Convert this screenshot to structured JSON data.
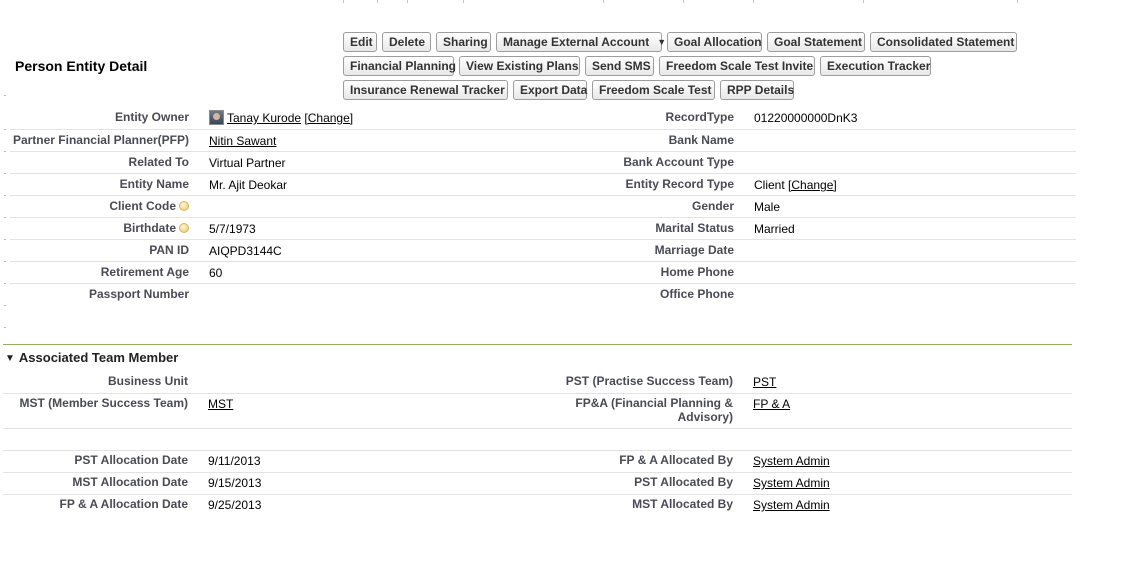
{
  "page_title": "Person Entity Detail",
  "buttons": {
    "row1": [
      "Edit",
      "Delete",
      "Sharing",
      "Manage External Account",
      "Goal Allocation",
      "Goal Statement",
      "Consolidated Statement"
    ],
    "row2": [
      "Financial Planning",
      "View Existing Plans",
      "Send SMS",
      "Freedom Scale Test Invite",
      "Execution Tracker"
    ],
    "row3": [
      "Insurance Renewal Tracker",
      "Export Data",
      "Freedom Scale Test",
      "RPP Details"
    ]
  },
  "detail": {
    "left": [
      {
        "label": "Entity Owner",
        "value": "Tanay Kurode",
        "change": "[Change]"
      },
      {
        "label": "Partner Financial Planner(PFP)",
        "value": "Nitin Sawant"
      },
      {
        "label": "Related To",
        "value": "Virtual Partner"
      },
      {
        "label": "Entity Name",
        "value": "Mr. Ajit Deokar"
      },
      {
        "label": "Client Code",
        "value": ""
      },
      {
        "label": "Birthdate",
        "value": "5/7/1973"
      },
      {
        "label": "PAN ID",
        "value": "AIQPD3144C"
      },
      {
        "label": "Retirement Age",
        "value": "60"
      },
      {
        "label": "Passport Number",
        "value": ""
      }
    ],
    "right": [
      {
        "label": "RecordType",
        "value": "01220000000DnK3"
      },
      {
        "label": "Bank Name",
        "value": ""
      },
      {
        "label": "Bank Account Type",
        "value": ""
      },
      {
        "label": "Entity Record Type",
        "value": "Client",
        "change": "[Change]"
      },
      {
        "label": "Gender",
        "value": "Male"
      },
      {
        "label": "Marital Status",
        "value": "Married"
      },
      {
        "label": "Marriage Date",
        "value": ""
      },
      {
        "label": "Home Phone",
        "value": ""
      },
      {
        "label": "Office Phone",
        "value": ""
      }
    ]
  },
  "team_section": {
    "title": "Associated Team Member",
    "rows": [
      {
        "left_label": "Business Unit",
        "left_value": "",
        "right_label": "PST (Practise Success Team)",
        "right_value": "PST"
      },
      {
        "left_label": "MST (Member Success Team)",
        "left_value": "MST",
        "right_label": "FP&A (Financial Planning & Advisory)",
        "right_value": "FP & A"
      },
      {
        "left_label": "PST Allocation Date",
        "left_value": "9/11/2013",
        "right_label": "FP & A Allocated By",
        "right_value": "System Admin"
      },
      {
        "left_label": "MST Allocation Date",
        "left_value": "9/15/2013",
        "right_label": "PST Allocated By",
        "right_value": "System Admin"
      },
      {
        "left_label": "FP & A Allocation Date",
        "left_value": "9/25/2013",
        "right_label": "MST Allocated By",
        "right_value": "System Admin"
      }
    ]
  }
}
